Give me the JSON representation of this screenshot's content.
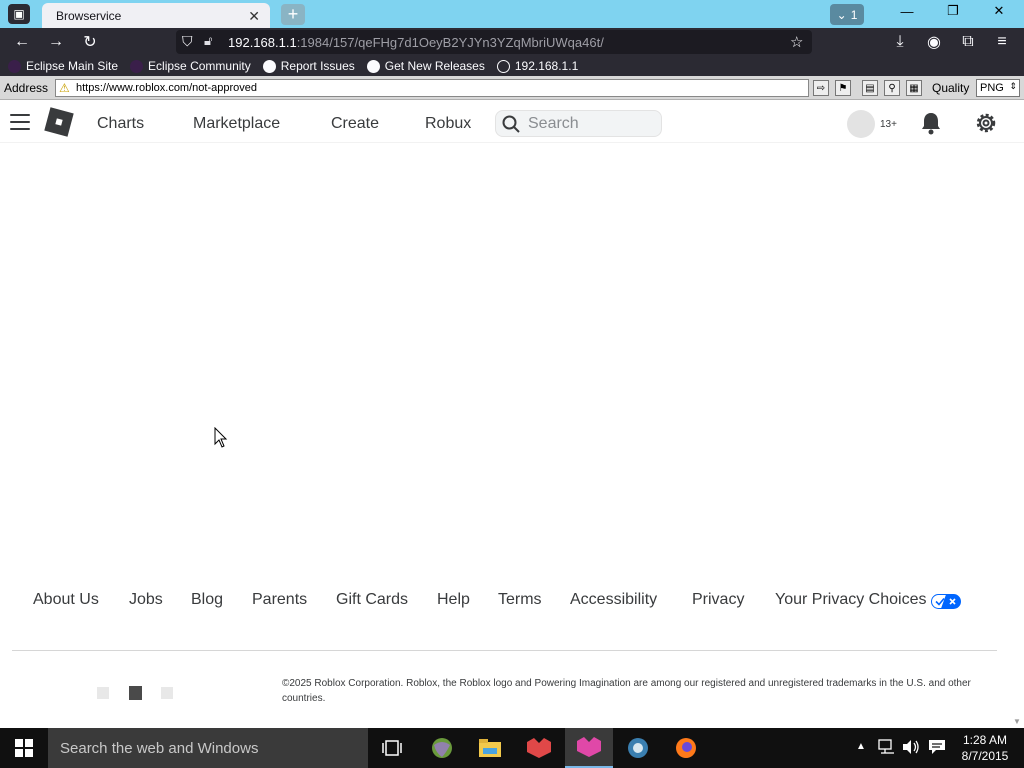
{
  "browser": {
    "tab_title": "Browservice",
    "tab_count": "1",
    "url_host": "192.168.1.1",
    "url_path": ":1984/157/qeFHg7d1OeyB2YJYn3YZqMbriUWqa46t/",
    "bookmarks": [
      {
        "label": "Eclipse Main Site"
      },
      {
        "label": "Eclipse Community"
      },
      {
        "label": "Report Issues"
      },
      {
        "label": "Get New Releases"
      },
      {
        "label": "192.168.1.1"
      }
    ]
  },
  "browservice": {
    "address_label": "Address",
    "address_value": "https://www.roblox.com/not-approved",
    "quality_label": "Quality",
    "quality_value": "PNG"
  },
  "roblox": {
    "nav": {
      "charts": "Charts",
      "marketplace": "Marketplace",
      "create": "Create",
      "robux": "Robux"
    },
    "search_placeholder": "Search",
    "age_badge": "13+",
    "footer_links": [
      "About Us",
      "Jobs",
      "Blog",
      "Parents",
      "Gift Cards",
      "Help",
      "Terms",
      "Accessibility",
      "Privacy",
      "Your Privacy Choices"
    ],
    "copyright": "©2025 Roblox Corporation. Roblox, the Roblox logo and Powering Imagination are among our registered and unregistered trademarks in the U.S. and other countries."
  },
  "taskbar": {
    "search_placeholder": "Search the web and Windows",
    "time": "1:28 AM",
    "date": "8/7/2015"
  },
  "colors": {
    "tabstrip": "#7fd3f0",
    "toolbar": "#2b2a33",
    "taskbar": "#101010",
    "roblox_text": "#393b3d"
  }
}
